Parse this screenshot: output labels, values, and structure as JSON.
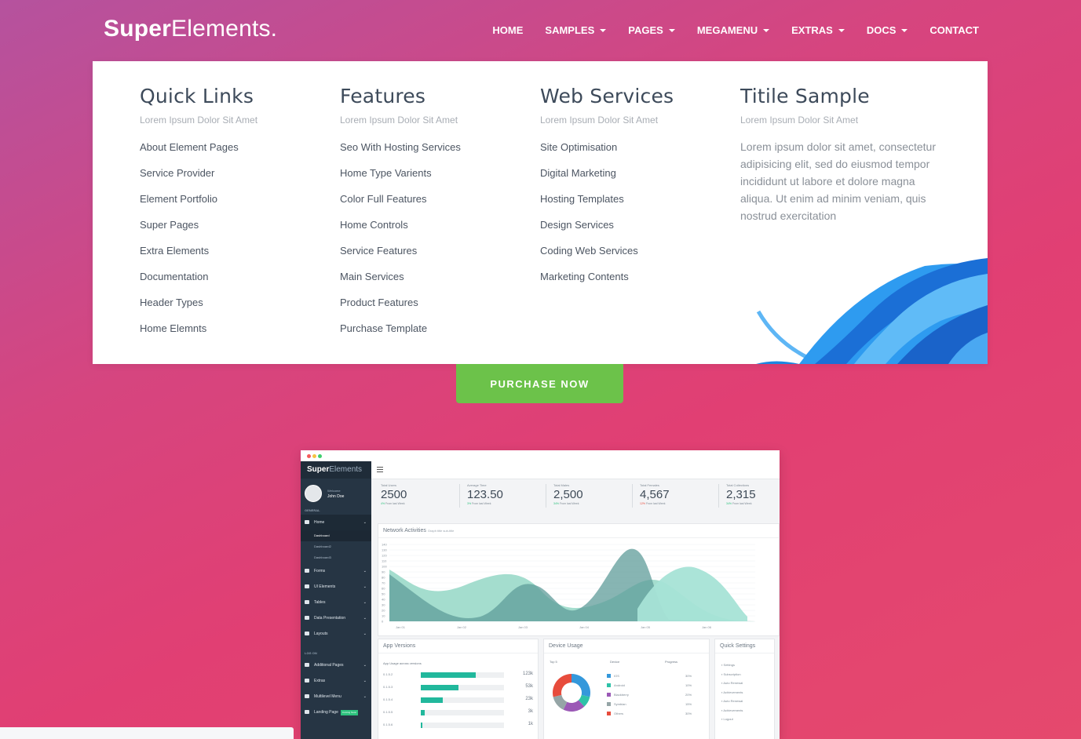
{
  "brand": {
    "bold": "Super",
    "light": "Elements."
  },
  "nav": [
    {
      "label": "HOME",
      "caret": false
    },
    {
      "label": "SAMPLES",
      "caret": true
    },
    {
      "label": "PAGES",
      "caret": true
    },
    {
      "label": "MEGAMENU",
      "caret": true
    },
    {
      "label": "EXTRAS",
      "caret": true
    },
    {
      "label": "DOCS",
      "caret": true
    },
    {
      "label": "CONTACT",
      "caret": false
    }
  ],
  "megamenu": {
    "columns": [
      {
        "title": "Quick Links",
        "subtitle": "Lorem Ipsum Dolor Sit Amet",
        "links": [
          "About Element Pages",
          "Service Provider",
          "Element Portfolio",
          "Super Pages",
          "Extra Elements",
          "Documentation",
          "Header Types",
          "Home Elemnts"
        ]
      },
      {
        "title": "Features",
        "subtitle": "Lorem Ipsum Dolor Sit Amet",
        "links": [
          "Seo With Hosting Services",
          "Home Type Varients",
          "Color Full Features",
          "Home Controls",
          "Service Features",
          "Main Services",
          "Product Features",
          "Purchase Template"
        ]
      },
      {
        "title": "Web Services",
        "subtitle": "Lorem Ipsum Dolor Sit Amet",
        "links": [
          "Site Optimisation",
          "Digital Marketing",
          "Hosting Templates",
          "Design Services",
          "Coding Web Services",
          "Marketing Contents"
        ]
      },
      {
        "title": "Titile Sample",
        "subtitle": "Lorem Ipsum Dolor Sit Amet",
        "paragraph": "Lorem ipsum dolor sit amet, consectetur adipisicing elit, sed do eiusmod tempor incididunt ut labore et dolore magna aliqua. Ut enim ad minim veniam, quis nostrud exercitation"
      }
    ]
  },
  "purchase_button": "PURCHASE NOW",
  "dashboard": {
    "brand": {
      "bold": "Super",
      "light": "Elements"
    },
    "user": {
      "welcome": "Welcome",
      "name": "John Doe"
    },
    "sections": {
      "general": "GENERAL",
      "log_on": "LOG ON"
    },
    "menu": [
      {
        "label": "Home",
        "active": true
      },
      {
        "label": "Forms"
      },
      {
        "label": "UI Elements"
      },
      {
        "label": "Tables"
      },
      {
        "label": "Data Presentation"
      },
      {
        "label": "Layouts"
      }
    ],
    "submenu": [
      "Dashboard",
      "Dashboard2",
      "Dashboard3"
    ],
    "menu2": [
      {
        "label": "Additional Pages"
      },
      {
        "label": "Extras"
      },
      {
        "label": "Multilevel Menu"
      },
      {
        "label": "Landing Page",
        "badge": "Coming Soon"
      }
    ],
    "stats": [
      {
        "label": "Total Users",
        "value": "2500",
        "delta": "4%",
        "note": "From last Week"
      },
      {
        "label": "Average Time",
        "value": "123.50",
        "delta": "3%",
        "note": "From last Week"
      },
      {
        "label": "Total Males",
        "value": "2,500",
        "delta": "34%",
        "note": "From last Week"
      },
      {
        "label": "Total Females",
        "value": "4,567",
        "delta": "12%",
        "note": "From last Week"
      },
      {
        "label": "Total Collections",
        "value": "2,315",
        "delta": "34%",
        "note": "From last Week"
      }
    ],
    "network": {
      "title": "Network Activities",
      "subtitle": "Graph title sub-title",
      "y_ticks": [
        "140",
        "130",
        "120",
        "110",
        "100",
        "90",
        "80",
        "70",
        "60",
        "50",
        "40",
        "30",
        "20",
        "10",
        "0"
      ],
      "x_ticks": [
        "Jan 01",
        "Jan 02",
        "Jan 03",
        "Jan 04",
        "Jan 05",
        "Jan 06"
      ]
    },
    "app_versions": {
      "title": "App Versions",
      "subtitle": "App Usage across versions",
      "rows": [
        {
          "label": "0.1.5.2",
          "fill": 0.66,
          "value": "123k"
        },
        {
          "label": "0.1.5.3",
          "fill": 0.45,
          "value": "53k"
        },
        {
          "label": "0.1.5.4",
          "fill": 0.26,
          "value": "23k"
        },
        {
          "label": "0.1.5.5",
          "fill": 0.05,
          "value": "3k"
        },
        {
          "label": "0.1.5.6",
          "fill": 0.02,
          "value": "1k"
        }
      ]
    },
    "device_usage": {
      "title": "Device Usage",
      "top": "Top 5",
      "col_device": "Device",
      "col_progress": "Progress",
      "rows": [
        {
          "name": "IOS",
          "color": "#3498db",
          "pct": "30%"
        },
        {
          "name": "Android",
          "color": "#2ec2a8",
          "pct": "10%"
        },
        {
          "name": "Blackberry",
          "color": "#9b59b6",
          "pct": "20%"
        },
        {
          "name": "Symbian",
          "color": "#95a5a6",
          "pct": "15%"
        },
        {
          "name": "Others",
          "color": "#e74c3c",
          "pct": "30%"
        }
      ]
    },
    "quick_settings": {
      "title": "Quick Settings",
      "items": [
        "Settings",
        "Subscription",
        "Auto Renewal",
        "Achievements",
        "Auto Renewal",
        "Achievements",
        "Logout"
      ]
    }
  }
}
